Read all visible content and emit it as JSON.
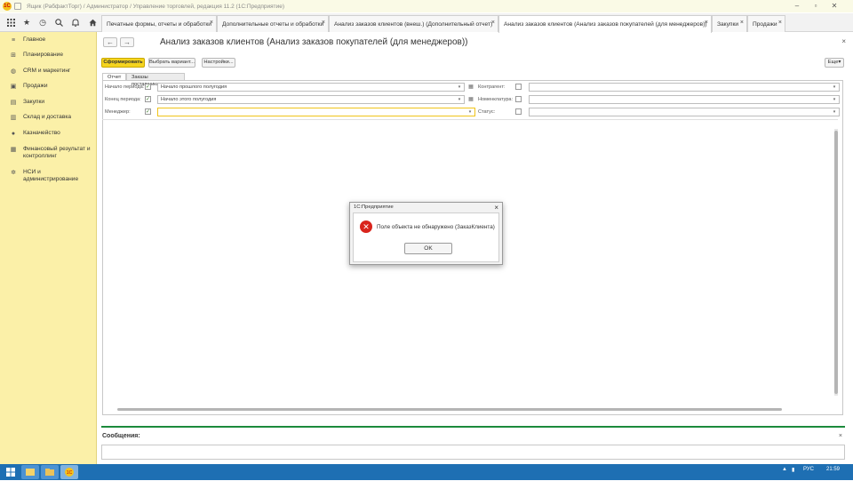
{
  "window": {
    "title": "Ящик (РабфактТорг) / Администратор / Управление торговлей, редакция 11.2 (1С:Предприятие)",
    "logo_text": "1С"
  },
  "toolbar": {
    "icons": [
      "apps-grid-icon",
      "star-icon",
      "history-icon",
      "search-icon",
      "bell-icon",
      "home-icon"
    ],
    "tabs": [
      {
        "label": "Печатные формы, отчеты и обработки",
        "active": false
      },
      {
        "label": "Дополнительные отчеты и обработки",
        "active": false
      },
      {
        "label": "Анализ заказов клиентов (внеш.) (Дополнительный отчет)",
        "active": false
      },
      {
        "label": "Анализ заказов клиентов (Анализ заказов покупателей (для менеджеров))",
        "active": true
      },
      {
        "label": "Закупки",
        "active": false
      },
      {
        "label": "Продажи",
        "active": false
      }
    ],
    "tab_close_glyph": "×"
  },
  "sidebar": {
    "items": [
      {
        "label": "Главное",
        "icon": "menu-lines-icon"
      },
      {
        "label": "Планирование",
        "icon": "planning-icon"
      },
      {
        "label": "CRM и маркетинг",
        "icon": "crm-icon"
      },
      {
        "label": "Продажи",
        "icon": "bag-icon"
      },
      {
        "label": "Закупки",
        "icon": "cart-icon"
      },
      {
        "label": "Склад и доставка",
        "icon": "warehouse-icon"
      },
      {
        "label": "Казначейство",
        "icon": "treasury-icon"
      },
      {
        "label": "Финансовый результат и контроллинг",
        "icon": "chart-icon"
      },
      {
        "label": "НСИ и администрирование",
        "icon": "gear-icon"
      }
    ]
  },
  "form": {
    "back_glyph": "←",
    "forward_glyph": "→",
    "title": "Анализ заказов клиентов (Анализ заказов покупателей (для менеджеров))",
    "close_glyph": "×",
    "buttons": {
      "generate": "Сформировать",
      "choose_variant": "Выбрать вариант...",
      "settings": "Настройки...",
      "more": "Еще"
    },
    "subtabs": [
      {
        "label": "Отчет",
        "active": true
      },
      {
        "label": "Заказы поставщикам",
        "active": false
      }
    ],
    "filters_left": [
      {
        "label": "Начало периода:",
        "checked": true,
        "value": "Начало прошлого полугодия"
      },
      {
        "label": "Конец периода:",
        "checked": true,
        "value": "Начало этого полугодия"
      },
      {
        "label": "Менеджер:",
        "checked": true,
        "value": ""
      }
    ],
    "filters_right": [
      {
        "label": "Контрагент:",
        "checked": false,
        "value": ""
      },
      {
        "label": "Номенклатура:",
        "checked": false,
        "value": ""
      },
      {
        "label": "Статус:",
        "checked": false,
        "value": ""
      }
    ],
    "check_glyph": "✓",
    "dropdown_glyph": "▾"
  },
  "messages": {
    "title": "Сообщения:",
    "close_glyph": "×"
  },
  "dialog": {
    "title": "1С:Предприятие",
    "message": "Поле объекта не обнаружено (ЗаказКлиента)",
    "ok_label": "OK",
    "close_glyph": "×",
    "error_glyph": "✕"
  },
  "taskbar": {
    "language": "РУС",
    "time": "21:59"
  },
  "colors": {
    "accent_yellow": "#f5d41f",
    "sidebar_bg": "#fbf0a8",
    "error_red": "#d9241c",
    "message_green": "#1c8a3c",
    "taskbar_blue": "#1e6fb3"
  }
}
